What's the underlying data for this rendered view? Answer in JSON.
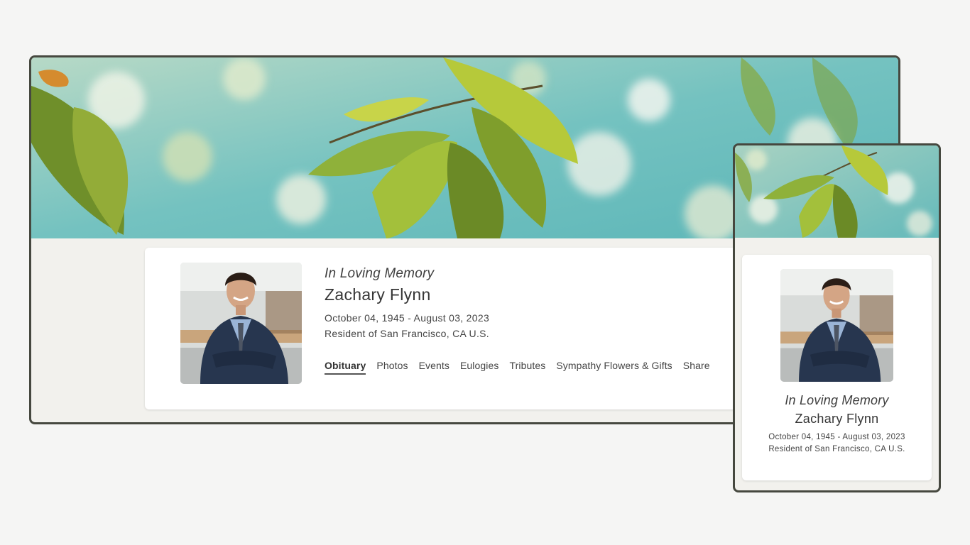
{
  "memorial": {
    "label": "In Loving Memory",
    "name": "Zachary Flynn",
    "dates": "October 04, 1945 - August 03, 2023",
    "residence": "Resident of San Francisco, CA U.S."
  },
  "tabs": [
    {
      "label": "Obituary",
      "active": true
    },
    {
      "label": "Photos"
    },
    {
      "label": "Events"
    },
    {
      "label": "Eulogies"
    },
    {
      "label": "Tributes"
    },
    {
      "label": "Sympathy Flowers & Gifts"
    },
    {
      "label": "Share"
    }
  ],
  "colors": {
    "background": "#f5f5f4",
    "frame": "#46483f",
    "page": "#f2f1ed",
    "card": "#ffffff",
    "text": "#3b3b3b"
  },
  "icons": {
    "banner": "green-leaves-banner",
    "portrait": "man-in-suit-portrait"
  }
}
